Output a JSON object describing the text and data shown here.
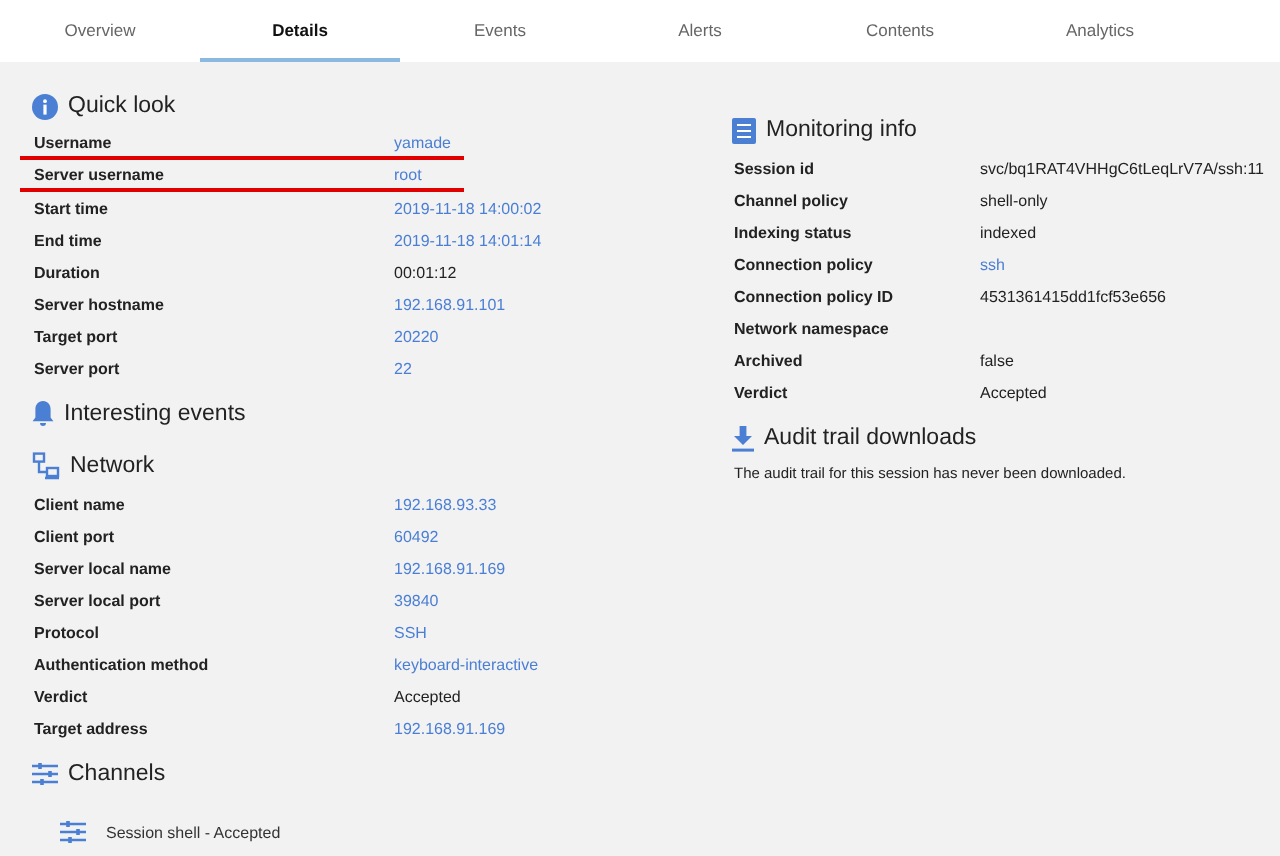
{
  "tabs": [
    {
      "label": "Overview",
      "selected": false
    },
    {
      "label": "Details",
      "selected": true
    },
    {
      "label": "Events",
      "selected": false
    },
    {
      "label": "Alerts",
      "selected": false
    },
    {
      "label": "Contents",
      "selected": false
    },
    {
      "label": "Analytics",
      "selected": false
    }
  ],
  "left": [
    {
      "kind": "info",
      "title": "Quick look",
      "rows": [
        {
          "label": "Username",
          "value": "yamade",
          "link": true,
          "underlined": true
        },
        {
          "label": "Server username",
          "value": "root",
          "link": true,
          "underlined": true
        },
        {
          "label": "Start time",
          "value": "2019-11-18 14:00:02",
          "link": true,
          "underlined": false
        },
        {
          "label": "End time",
          "value": "2019-11-18 14:01:14",
          "link": true,
          "underlined": false
        },
        {
          "label": "Duration",
          "value": "00:01:12",
          "link": false,
          "underlined": false
        },
        {
          "label": "Server hostname",
          "value": "192.168.91.101",
          "link": true,
          "underlined": false
        },
        {
          "label": "Target port",
          "value": "20220",
          "link": true,
          "underlined": false
        },
        {
          "label": "Server port",
          "value": "22",
          "link": true,
          "underlined": false
        }
      ]
    },
    {
      "kind": "bell",
      "title": "Interesting events"
    },
    {
      "kind": "network",
      "title": "Network",
      "rows": [
        {
          "label": "Client name",
          "value": "192.168.93.33",
          "link": true
        },
        {
          "label": "Client port",
          "value": "60492",
          "link": true
        },
        {
          "label": "Server local name",
          "value": "192.168.91.169",
          "link": true
        },
        {
          "label": "Server local port",
          "value": "39840",
          "link": true
        },
        {
          "label": "Protocol",
          "value": "SSH",
          "link": true
        },
        {
          "label": "Authentication method",
          "value": "keyboard-interactive",
          "link": true
        },
        {
          "label": "Verdict",
          "value": "Accepted",
          "link": false
        },
        {
          "label": "Target address",
          "value": "192.168.91.169",
          "link": true
        }
      ]
    },
    {
      "kind": "sliders",
      "title": "Channels",
      "channels": [
        "Session shell - Accepted"
      ]
    }
  ],
  "right": [
    {
      "kind": "doc",
      "title": "Monitoring info",
      "rows": [
        {
          "label": "Session id",
          "value": "svc/bq1RAT4VHHgC6tLeqLrV7A/ssh:11",
          "link": false
        },
        {
          "label": "Channel policy",
          "value": "shell-only",
          "link": false
        },
        {
          "label": "Indexing status",
          "value": "indexed",
          "link": false
        },
        {
          "label": "Connection policy",
          "value": "ssh",
          "link": true
        },
        {
          "label": "Connection policy ID",
          "value": "4531361415dd1fcf53e656",
          "link": false
        },
        {
          "label": "Network namespace"
        },
        {
          "label": "Archived",
          "value": "false",
          "link": false
        },
        {
          "label": "Verdict",
          "value": "Accepted",
          "link": false
        }
      ]
    },
    {
      "kind": "download",
      "title": "Audit trail downloads",
      "note": "The audit trail for this session has never been downloaded."
    }
  ]
}
